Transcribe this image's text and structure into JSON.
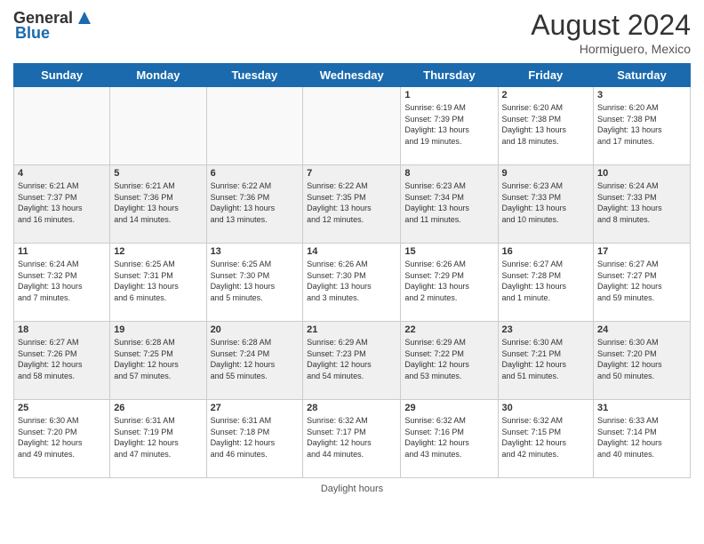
{
  "header": {
    "logo_general": "General",
    "logo_blue": "Blue",
    "month_year": "August 2024",
    "location": "Hormiguero, Mexico"
  },
  "days_of_week": [
    "Sunday",
    "Monday",
    "Tuesday",
    "Wednesday",
    "Thursday",
    "Friday",
    "Saturday"
  ],
  "weeks": [
    [
      {
        "day": "",
        "info": "",
        "empty": true
      },
      {
        "day": "",
        "info": "",
        "empty": true
      },
      {
        "day": "",
        "info": "",
        "empty": true
      },
      {
        "day": "",
        "info": "",
        "empty": true
      },
      {
        "day": "1",
        "info": "Sunrise: 6:19 AM\nSunset: 7:39 PM\nDaylight: 13 hours\nand 19 minutes.",
        "empty": false
      },
      {
        "day": "2",
        "info": "Sunrise: 6:20 AM\nSunset: 7:38 PM\nDaylight: 13 hours\nand 18 minutes.",
        "empty": false
      },
      {
        "day": "3",
        "info": "Sunrise: 6:20 AM\nSunset: 7:38 PM\nDaylight: 13 hours\nand 17 minutes.",
        "empty": false
      }
    ],
    [
      {
        "day": "4",
        "info": "Sunrise: 6:21 AM\nSunset: 7:37 PM\nDaylight: 13 hours\nand 16 minutes.",
        "empty": false,
        "shaded": true
      },
      {
        "day": "5",
        "info": "Sunrise: 6:21 AM\nSunset: 7:36 PM\nDaylight: 13 hours\nand 14 minutes.",
        "empty": false,
        "shaded": true
      },
      {
        "day": "6",
        "info": "Sunrise: 6:22 AM\nSunset: 7:36 PM\nDaylight: 13 hours\nand 13 minutes.",
        "empty": false,
        "shaded": true
      },
      {
        "day": "7",
        "info": "Sunrise: 6:22 AM\nSunset: 7:35 PM\nDaylight: 13 hours\nand 12 minutes.",
        "empty": false,
        "shaded": true
      },
      {
        "day": "8",
        "info": "Sunrise: 6:23 AM\nSunset: 7:34 PM\nDaylight: 13 hours\nand 11 minutes.",
        "empty": false,
        "shaded": true
      },
      {
        "day": "9",
        "info": "Sunrise: 6:23 AM\nSunset: 7:33 PM\nDaylight: 13 hours\nand 10 minutes.",
        "empty": false,
        "shaded": true
      },
      {
        "day": "10",
        "info": "Sunrise: 6:24 AM\nSunset: 7:33 PM\nDaylight: 13 hours\nand 8 minutes.",
        "empty": false,
        "shaded": true
      }
    ],
    [
      {
        "day": "11",
        "info": "Sunrise: 6:24 AM\nSunset: 7:32 PM\nDaylight: 13 hours\nand 7 minutes.",
        "empty": false
      },
      {
        "day": "12",
        "info": "Sunrise: 6:25 AM\nSunset: 7:31 PM\nDaylight: 13 hours\nand 6 minutes.",
        "empty": false
      },
      {
        "day": "13",
        "info": "Sunrise: 6:25 AM\nSunset: 7:30 PM\nDaylight: 13 hours\nand 5 minutes.",
        "empty": false
      },
      {
        "day": "14",
        "info": "Sunrise: 6:26 AM\nSunset: 7:30 PM\nDaylight: 13 hours\nand 3 minutes.",
        "empty": false
      },
      {
        "day": "15",
        "info": "Sunrise: 6:26 AM\nSunset: 7:29 PM\nDaylight: 13 hours\nand 2 minutes.",
        "empty": false
      },
      {
        "day": "16",
        "info": "Sunrise: 6:27 AM\nSunset: 7:28 PM\nDaylight: 13 hours\nand 1 minute.",
        "empty": false
      },
      {
        "day": "17",
        "info": "Sunrise: 6:27 AM\nSunset: 7:27 PM\nDaylight: 12 hours\nand 59 minutes.",
        "empty": false
      }
    ],
    [
      {
        "day": "18",
        "info": "Sunrise: 6:27 AM\nSunset: 7:26 PM\nDaylight: 12 hours\nand 58 minutes.",
        "empty": false,
        "shaded": true
      },
      {
        "day": "19",
        "info": "Sunrise: 6:28 AM\nSunset: 7:25 PM\nDaylight: 12 hours\nand 57 minutes.",
        "empty": false,
        "shaded": true
      },
      {
        "day": "20",
        "info": "Sunrise: 6:28 AM\nSunset: 7:24 PM\nDaylight: 12 hours\nand 55 minutes.",
        "empty": false,
        "shaded": true
      },
      {
        "day": "21",
        "info": "Sunrise: 6:29 AM\nSunset: 7:23 PM\nDaylight: 12 hours\nand 54 minutes.",
        "empty": false,
        "shaded": true
      },
      {
        "day": "22",
        "info": "Sunrise: 6:29 AM\nSunset: 7:22 PM\nDaylight: 12 hours\nand 53 minutes.",
        "empty": false,
        "shaded": true
      },
      {
        "day": "23",
        "info": "Sunrise: 6:30 AM\nSunset: 7:21 PM\nDaylight: 12 hours\nand 51 minutes.",
        "empty": false,
        "shaded": true
      },
      {
        "day": "24",
        "info": "Sunrise: 6:30 AM\nSunset: 7:20 PM\nDaylight: 12 hours\nand 50 minutes.",
        "empty": false,
        "shaded": true
      }
    ],
    [
      {
        "day": "25",
        "info": "Sunrise: 6:30 AM\nSunset: 7:20 PM\nDaylight: 12 hours\nand 49 minutes.",
        "empty": false
      },
      {
        "day": "26",
        "info": "Sunrise: 6:31 AM\nSunset: 7:19 PM\nDaylight: 12 hours\nand 47 minutes.",
        "empty": false
      },
      {
        "day": "27",
        "info": "Sunrise: 6:31 AM\nSunset: 7:18 PM\nDaylight: 12 hours\nand 46 minutes.",
        "empty": false
      },
      {
        "day": "28",
        "info": "Sunrise: 6:32 AM\nSunset: 7:17 PM\nDaylight: 12 hours\nand 44 minutes.",
        "empty": false
      },
      {
        "day": "29",
        "info": "Sunrise: 6:32 AM\nSunset: 7:16 PM\nDaylight: 12 hours\nand 43 minutes.",
        "empty": false
      },
      {
        "day": "30",
        "info": "Sunrise: 6:32 AM\nSunset: 7:15 PM\nDaylight: 12 hours\nand 42 minutes.",
        "empty": false
      },
      {
        "day": "31",
        "info": "Sunrise: 6:33 AM\nSunset: 7:14 PM\nDaylight: 12 hours\nand 40 minutes.",
        "empty": false
      }
    ]
  ],
  "footer": {
    "daylight_hours_label": "Daylight hours"
  }
}
